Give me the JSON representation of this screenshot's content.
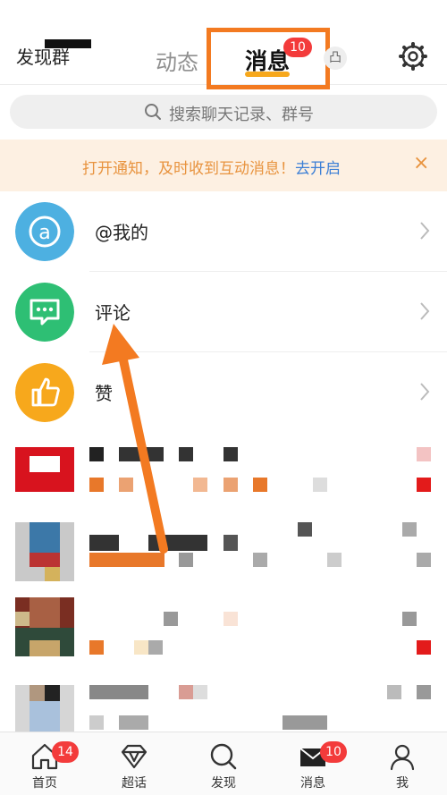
{
  "header": {
    "left_title": "发现群",
    "tab_dynamic": "动态",
    "tab_messages": "消息",
    "tab_messages_badge": "10",
    "extra_icon_glyph": "凸",
    "accent_color": "#f7a81c",
    "highlight_color": "#f37a21"
  },
  "search": {
    "placeholder": "搜索聊天记录、群号"
  },
  "notice": {
    "text": "打开通知，及时收到互动消息！",
    "link": "去开启",
    "close": "×"
  },
  "interactions": [
    {
      "label": "@我的",
      "icon": "at-icon",
      "color": "#4db0e1"
    },
    {
      "label": "评论",
      "icon": "comment-icon",
      "color": "#2ebf74"
    },
    {
      "label": "赞",
      "icon": "thumbs-up-icon",
      "color": "#f7a81c"
    }
  ],
  "tabbar": [
    {
      "label": "首页",
      "icon": "home-icon",
      "badge": "14"
    },
    {
      "label": "超话",
      "icon": "diamond-icon",
      "badge": ""
    },
    {
      "label": "发现",
      "icon": "discover-search-icon",
      "badge": ""
    },
    {
      "label": "消息",
      "icon": "message-envelope-icon",
      "badge": "10"
    },
    {
      "label": "我",
      "icon": "profile-icon",
      "badge": ""
    }
  ]
}
